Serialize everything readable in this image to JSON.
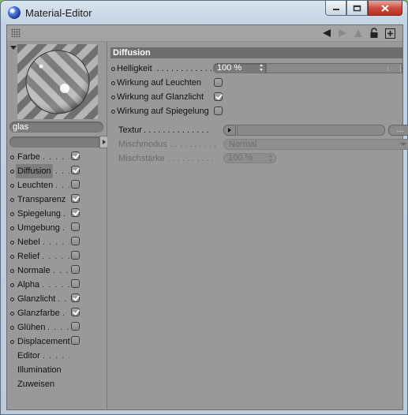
{
  "window": {
    "title": "Material-Editor",
    "icon": "cinema4d-sphere-icon",
    "controls": [
      "minimize-icon",
      "maximize-icon",
      "close-icon"
    ]
  },
  "toolbar": {
    "icons": [
      "back-arrow-icon",
      "forward-arrow-icon",
      "up-arrow-icon",
      "lock-icon",
      "new-window-icon"
    ]
  },
  "material": {
    "name": "glas"
  },
  "channels": [
    {
      "label": "Farbe",
      "dots": ". . . . .",
      "checkbox": true,
      "checked": true
    },
    {
      "label": "Diffusion",
      "dots": ". . . .",
      "checkbox": true,
      "checked": true,
      "selected": true
    },
    {
      "label": "Leuchten",
      "dots": ". . . .",
      "checkbox": true,
      "checked": false
    },
    {
      "label": "Transparenz",
      "dots": "",
      "checkbox": true,
      "checked": true
    },
    {
      "label": "Spiegelung",
      "dots": ". .",
      "checkbox": true,
      "checked": true
    },
    {
      "label": "Umgebung",
      "dots": ". .",
      "checkbox": true,
      "checked": false
    },
    {
      "label": "Nebel",
      "dots": ". . . . . .",
      "checkbox": true,
      "checked": false
    },
    {
      "label": "Relief",
      "dots": ". . . . . .",
      "checkbox": true,
      "checked": false
    },
    {
      "label": "Normale",
      "dots": ". . . .",
      "checkbox": true,
      "checked": false
    },
    {
      "label": "Alpha",
      "dots": ". . . . . .",
      "checkbox": true,
      "checked": false
    },
    {
      "label": "Glanzlicht",
      "dots": ". .",
      "checkbox": true,
      "checked": true
    },
    {
      "label": "Glanzfarbe",
      "dots": ". .",
      "checkbox": true,
      "checked": true
    },
    {
      "label": "Glühen",
      "dots": ". . . . . .",
      "checkbox": true,
      "checked": false
    },
    {
      "label": "Displacement",
      "dots": "",
      "checkbox": true,
      "checked": false
    },
    {
      "label": "Editor",
      "dots": ". . . . . .",
      "checkbox": false
    },
    {
      "label": "Illumination",
      "dots": "",
      "checkbox": false
    },
    {
      "label": "Zuweisen",
      "dots": "",
      "checkbox": false
    }
  ],
  "diffusion": {
    "header": "Diffusion",
    "helligkeit_label": "Helligkeit",
    "helligkeit_dots": ". . . . . . . . . . . .",
    "helligkeit_value": "100 %",
    "helligkeit_fraction": 1.0,
    "wirkung_leuchten_label": "Wirkung auf Leuchten",
    "wirkung_leuchten_checked": false,
    "wirkung_glanzlicht_label": "Wirkung auf Glanzlicht",
    "wirkung_glanzlicht_checked": true,
    "wirkung_spiegelung_label": "Wirkung auf Spiegelung",
    "wirkung_spiegelung_checked": false,
    "textur_label": "Textur",
    "textur_dots": ". . . . . . . . . . . . . .",
    "textur_more": "...",
    "mischmodus_label": "Mischmodus",
    "mischmodus_dots": ". . . . . . . . . .",
    "mischmodus_value": "Normal",
    "mischstaerke_label": "Mischstärke",
    "mischstaerke_dots": ". . . . . . . . . .",
    "mischstaerke_value": "100 %"
  }
}
